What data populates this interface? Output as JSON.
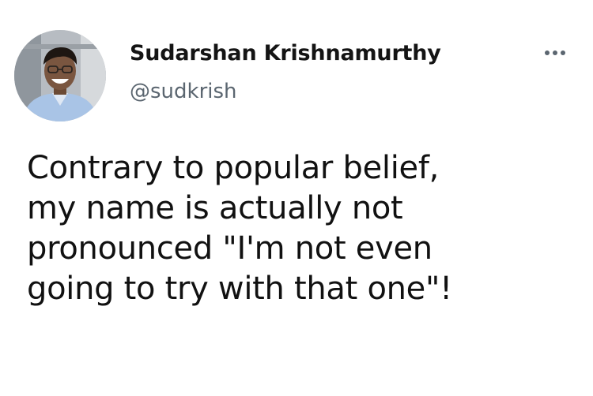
{
  "author": {
    "display_name": "Sudarshan Krishnamurthy",
    "handle": "@sudkrish",
    "avatar_icon": "profile-photo"
  },
  "menu": {
    "icon": "more-horizontal-icon"
  },
  "tweet": {
    "lines": [
      "Contrary to popular belief,",
      "my name is actually not",
      "pronounced \"I'm not even",
      "going to try with that one\"!"
    ]
  },
  "colors": {
    "background": "#ffffff",
    "text": "#111111",
    "secondary_text": "#5b6670"
  }
}
